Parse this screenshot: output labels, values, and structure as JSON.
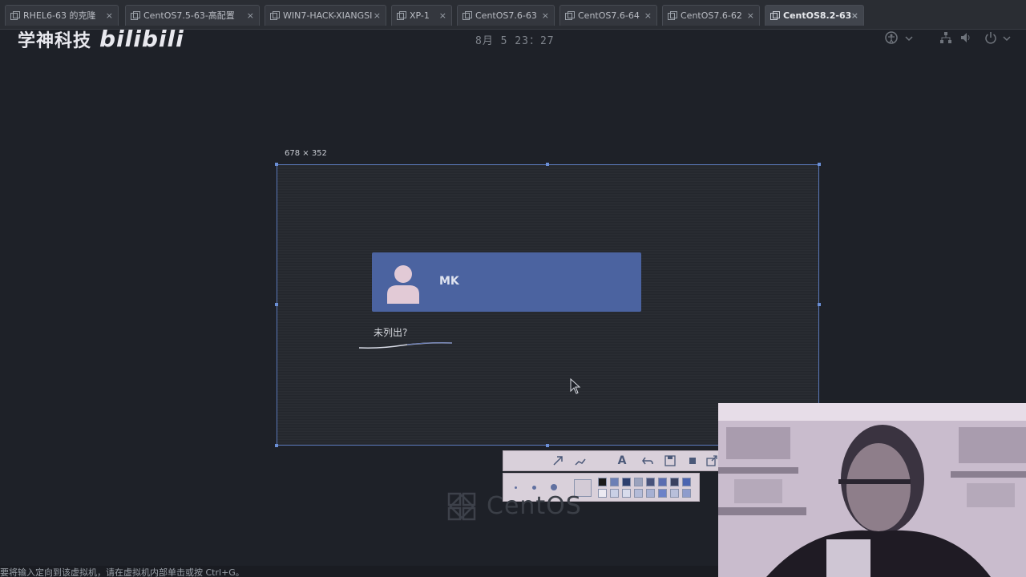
{
  "tabs": [
    {
      "label": "RHEL6-63 的克隆"
    },
    {
      "label": "CentOS7.5-63-高配置"
    },
    {
      "label": "WIN7-HACK-XIANGSI"
    },
    {
      "label": "XP-1"
    },
    {
      "label": "CentOS7.6-63"
    },
    {
      "label": "CentOS7.6-64"
    },
    {
      "label": "CentOS7.6-62"
    },
    {
      "label": "CentOS8.2-63"
    }
  ],
  "tab_close_glyph": "×",
  "watermark": {
    "text": "学神科技",
    "logo": "bilibili"
  },
  "clock": "8月 5  23：27",
  "capture": {
    "size_label": "678 × 352"
  },
  "login": {
    "user_name": "MK",
    "not_listed": "未列出?"
  },
  "toolbar": {
    "text_tool": "A"
  },
  "centos_word": "CentOS",
  "hint": "要将输入定向到该虚拟机，请在虚拟机内部单击或按 Ctrl+G。",
  "colors": {
    "accent": "#4b63a0",
    "selection": "#5a78b8",
    "background": "#1e2128"
  },
  "icons": [
    "accessibility-icon",
    "network-icon",
    "volume-icon",
    "power-icon",
    "user-avatar-icon",
    "cursor-icon",
    "centos-logo-icon"
  ]
}
